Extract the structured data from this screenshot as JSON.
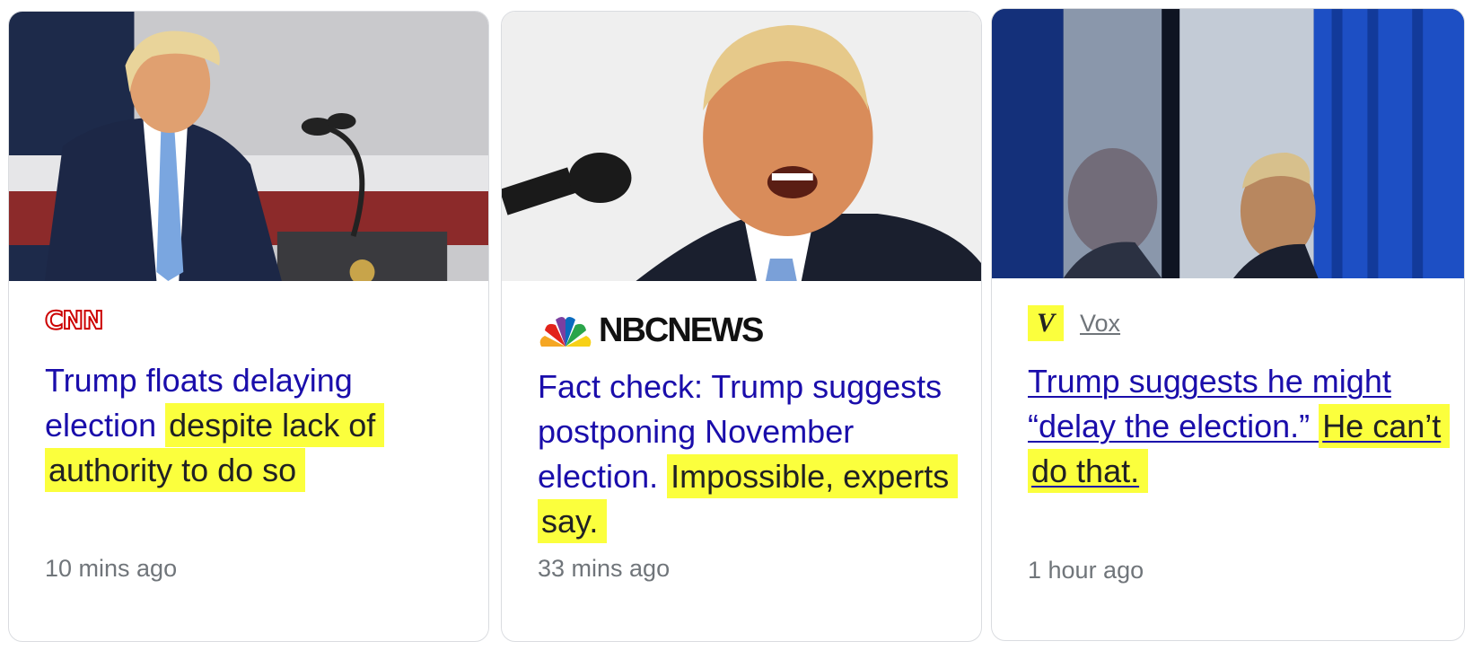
{
  "cards": [
    {
      "source": "CNN",
      "source_logo_text": "CNN",
      "headline_plain": "Trump floats delaying election ",
      "headline_highlight": "despite lack of authority to do so",
      "time": "10 mins ago"
    },
    {
      "source": "NBC NEWS",
      "source_logo_text": "NBCNEWS",
      "headline_plain": "Fact check: Trump suggests postponing November election. ",
      "headline_highlight": "Impossible, experts say.",
      "time": "33 mins ago"
    },
    {
      "source": "Vox",
      "source_logo_text": "V",
      "headline_plain": "Trump suggests he might “delay the election.” ",
      "headline_highlight": "He can’t do that.",
      "time": "1 hour ago"
    }
  ],
  "colors": {
    "headline": "#1a0dab",
    "highlight": "#fbff3d",
    "meta": "#70757a",
    "cnn_red": "#cc0000"
  },
  "icons": [
    "cnn-logo",
    "nbc-peacock-icon",
    "vox-logo"
  ]
}
